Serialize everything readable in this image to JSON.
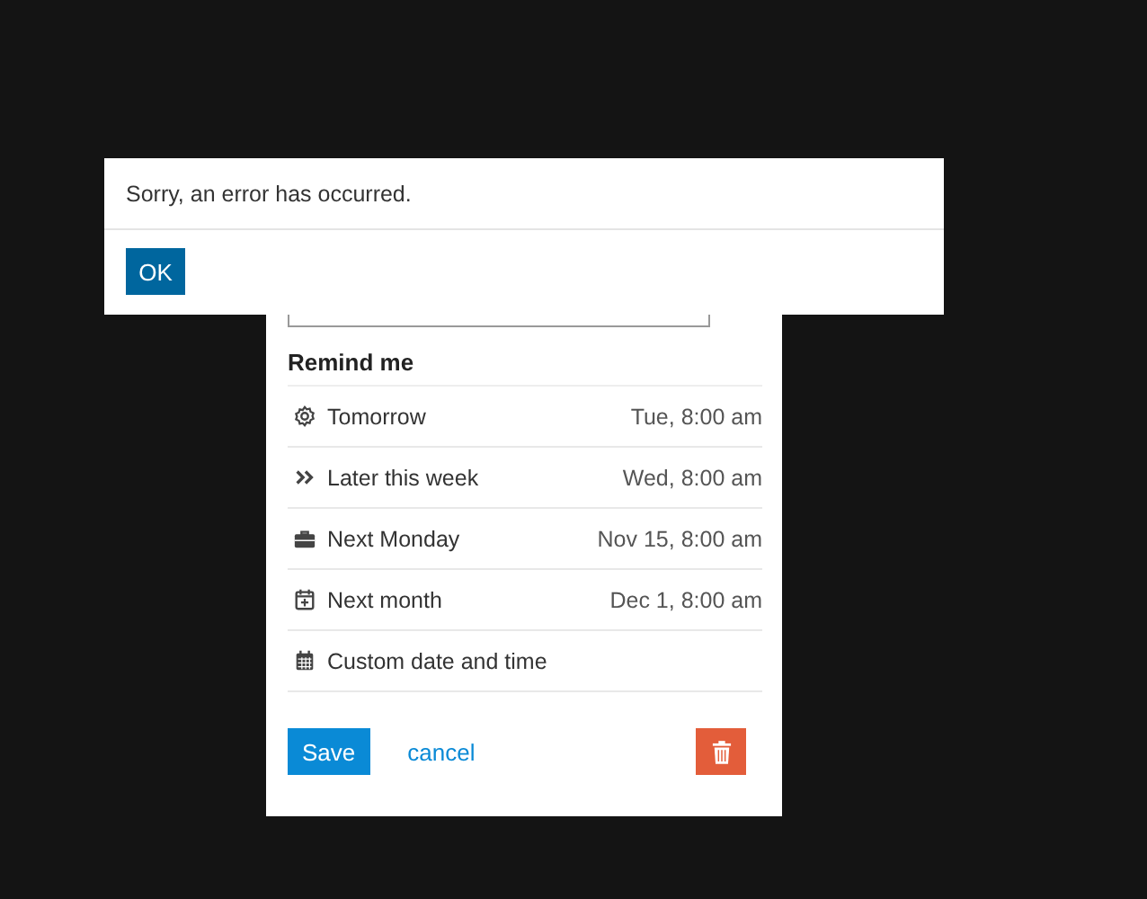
{
  "error_dialog": {
    "message": "Sorry, an error has occurred.",
    "button": "OK"
  },
  "reminder_panel": {
    "heading": "Remind me",
    "options": [
      {
        "label": "Tomorrow",
        "time": "Tue, 8:00 am"
      },
      {
        "label": "Later this week",
        "time": "Wed, 8:00 am"
      },
      {
        "label": "Next Monday",
        "time": "Nov 15, 8:00 am"
      },
      {
        "label": "Next month",
        "time": "Dec 1, 8:00 am"
      },
      {
        "label": "Custom date and time"
      }
    ],
    "save_button": "Save",
    "cancel_link": "cancel"
  }
}
